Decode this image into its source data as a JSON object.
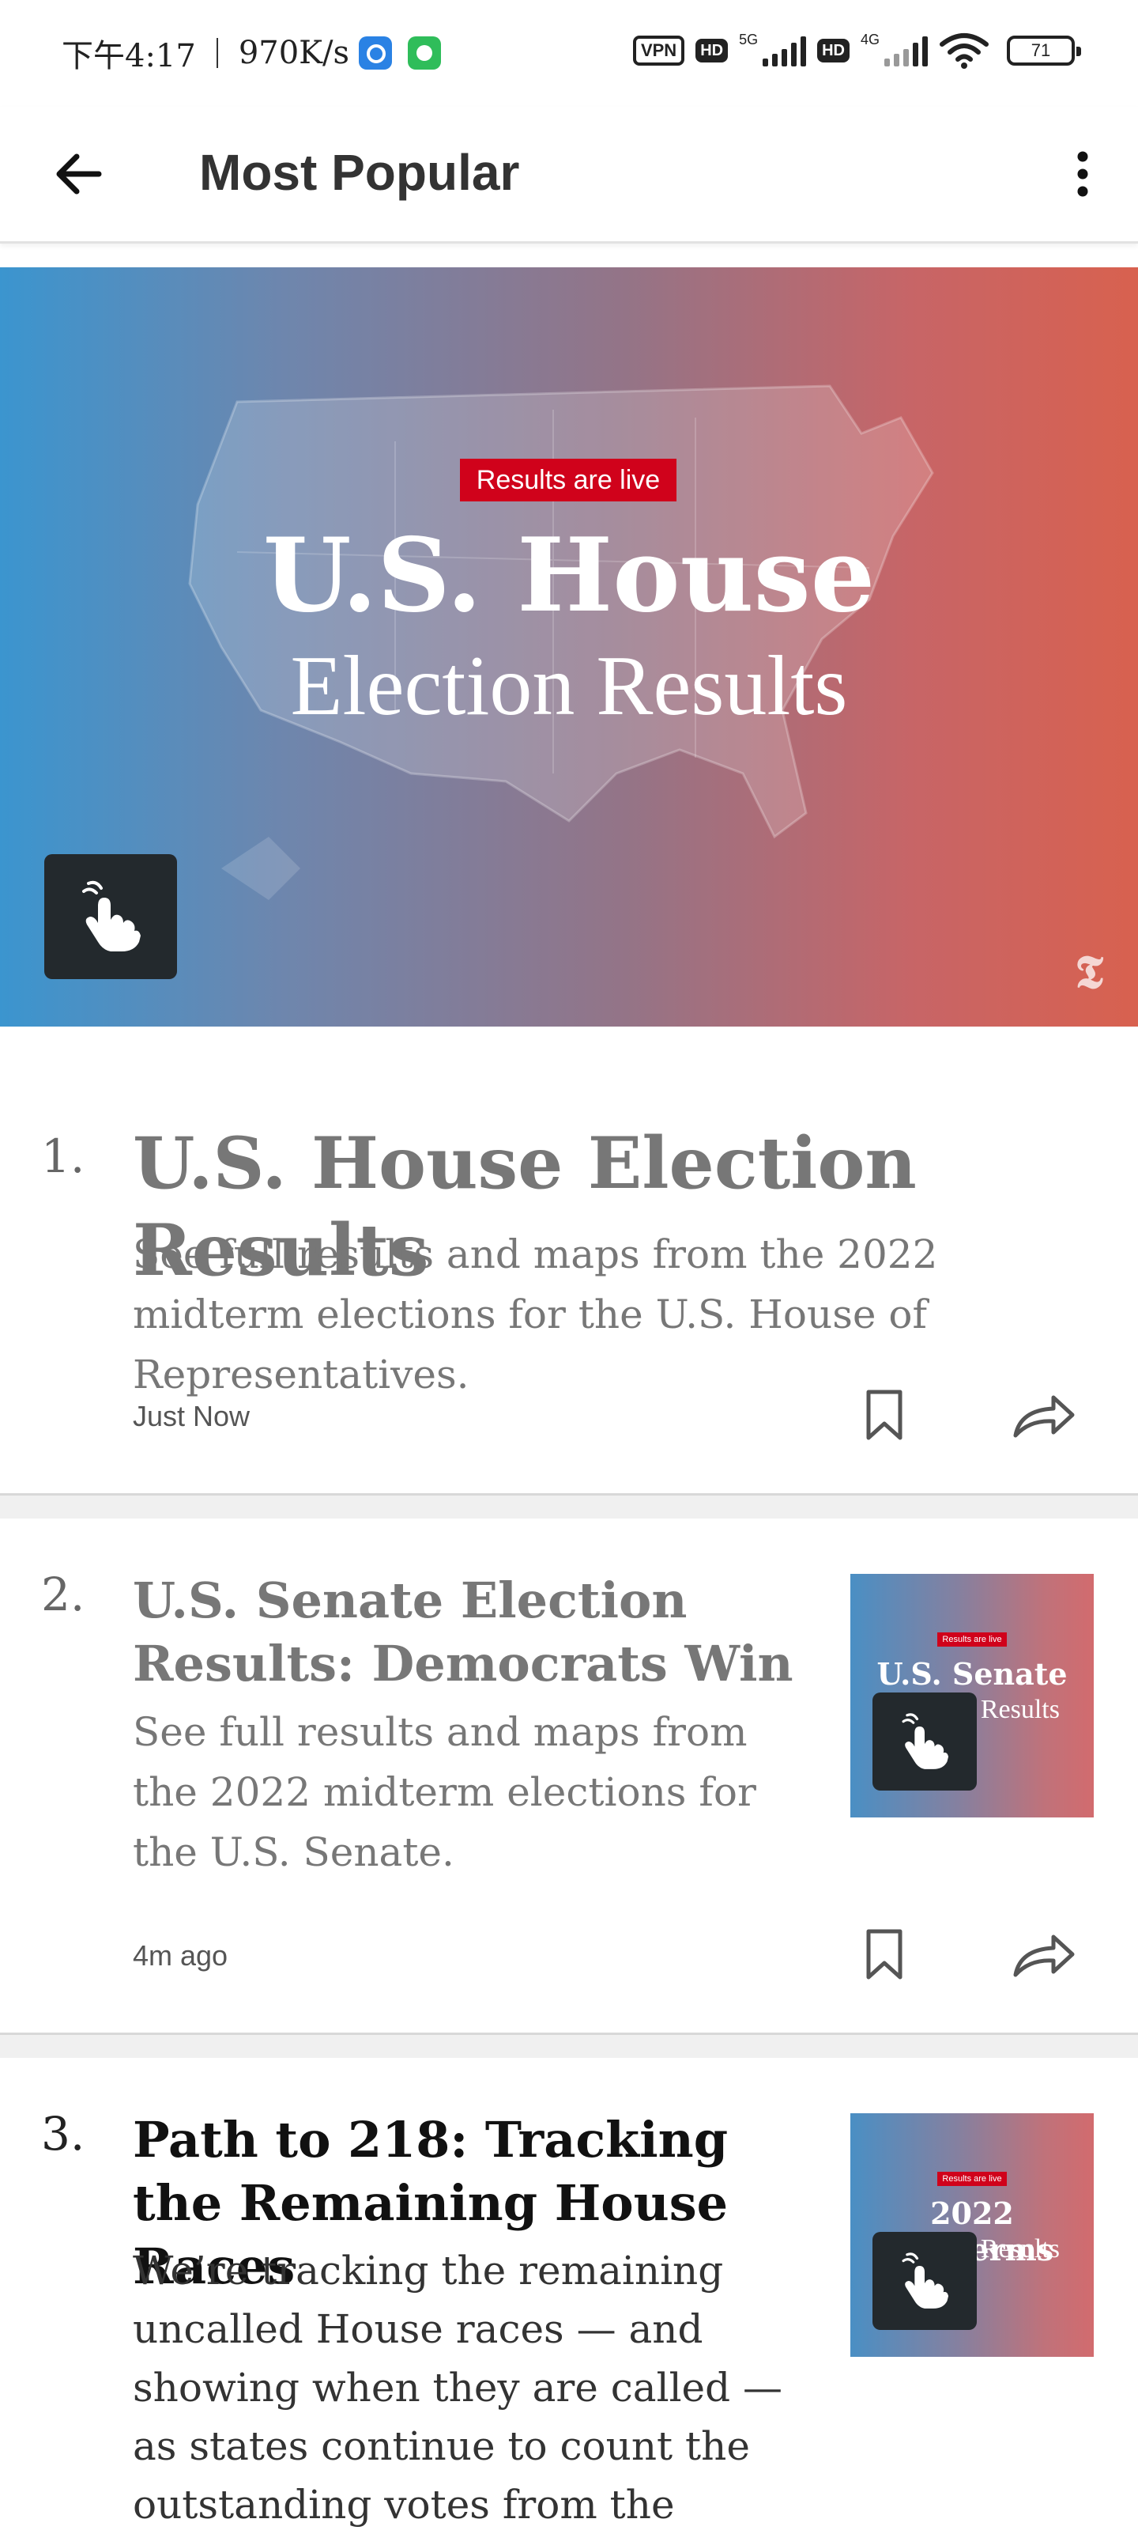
{
  "status_bar": {
    "time": "下午4:17",
    "speed": "970K/s",
    "vpn": "VPN",
    "hd": "HD",
    "net1": "5G",
    "net2": "4G",
    "battery": "71"
  },
  "app_bar": {
    "title": "Most Popular"
  },
  "hero": {
    "badge": "Results are live",
    "title": "U.S. House",
    "subtitle": "Election Results",
    "logo": "𝕿"
  },
  "articles": [
    {
      "number": "1.",
      "headline": "U.S. House Election Results",
      "summary": "See full results and maps from the 2022 midterm elections for the U.S. House of Representatives.",
      "time": "Just Now"
    },
    {
      "number": "2.",
      "headline": "U.S. Senate Election Results: Democrats Win",
      "summary": "See full results and maps from the 2022 midterm elections for the U.S. Senate.",
      "time": "4m ago",
      "thumb_badge": "Results are live",
      "thumb_title": "U.S. Senate",
      "thumb_sub": "Election Results"
    },
    {
      "number": "3.",
      "headline": "Path to 218: Tracking the Remaining House Races",
      "summary": "We’re tracking the remaining uncalled House races — and showing when they are called — as states continue to count the outstanding votes from the",
      "thumb_badge": "Results are live",
      "thumb_title": "2022 Midterms",
      "thumb_sub": "Election Results"
    }
  ]
}
